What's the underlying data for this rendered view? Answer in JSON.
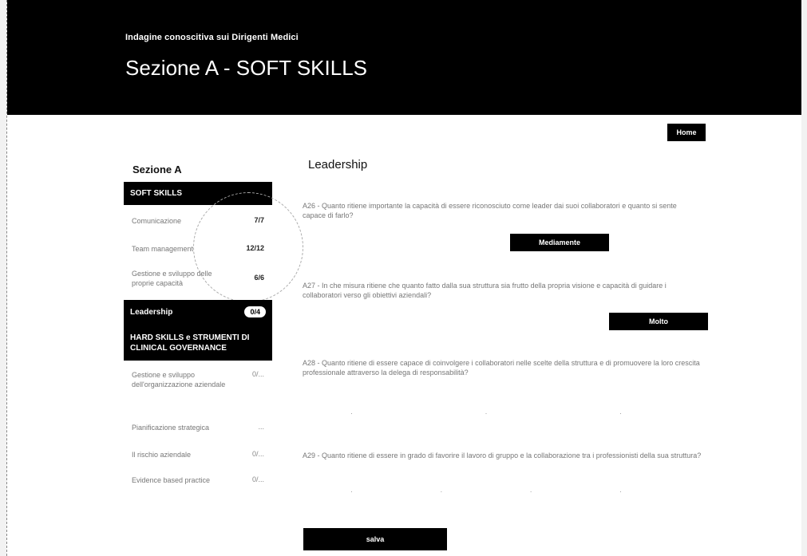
{
  "header": {
    "supertitle": "Indagine conoscitiva sui Dirigenti Medici",
    "title": "Sezione A - SOFT SKILLS"
  },
  "nav": {
    "home_label": "Home"
  },
  "sidebar": {
    "heading": "Sezione A",
    "groups": [
      {
        "label": "SOFT SKILLS",
        "items": [
          {
            "label": "Comunicazione",
            "count": "7/7"
          },
          {
            "label": "Team management",
            "count": "12/12"
          },
          {
            "label": "Gestione e sviluppo delle proprie capacità",
            "count": "6/6"
          }
        ]
      },
      {
        "label": "Leadership",
        "count": "0/4"
      },
      {
        "label": "HARD SKILLS e STRUMENTI DI CLINICAL GOVERNANCE",
        "items": [
          {
            "label": "Gestione e sviluppo dell'organizzazione aziendale",
            "count": "0/..."
          },
          {
            "label": "Pianificazione strategica",
            "count": "..."
          },
          {
            "label": "Il rischio aziendale",
            "count": "0/..."
          },
          {
            "label": "Evidence based practice",
            "count": "0/..."
          }
        ]
      }
    ]
  },
  "main": {
    "section_title": "Leadership",
    "questions": [
      {
        "text": "A26 - Quanto ritiene importante la capacità di essere riconosciuto come leader dai suoi collaboratori e quanto si sente capace di farlo?",
        "answer": "Mediamente"
      },
      {
        "text": "A27 - In che misura ritiene che quanto fatto dalla sua struttura sia frutto della propria visione e capacità di guidare i collaboratori verso gli obiettivi aziendali?",
        "answer": "Molto"
      },
      {
        "text": "A28 - Quanto ritiene di essere capace di coinvolgere i collaboratori nelle scelte della struttura e di promuovere la loro crescita professionale attraverso la delega di responsabilità?",
        "answer": ""
      },
      {
        "text": "A29 - Quanto ritiene di essere in grado di favorire il lavoro di gruppo e la collaborazione tra i professionisti della sua struttura?",
        "answer": ""
      }
    ],
    "save_label": "salva"
  }
}
